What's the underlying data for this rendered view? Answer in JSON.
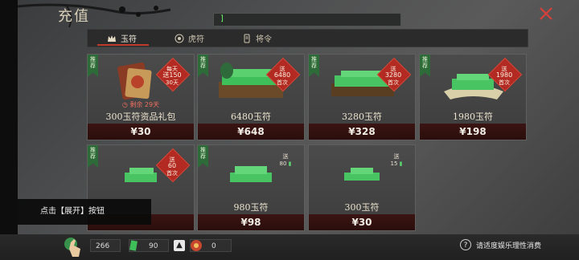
{
  "header": {
    "title": "充值",
    "search_value": "]"
  },
  "tabs": [
    {
      "label": "玉符",
      "icon": "crown-icon",
      "active": true
    },
    {
      "label": "虎符",
      "icon": "tiger-emblem-icon",
      "active": false
    },
    {
      "label": "将令",
      "icon": "order-token-icon",
      "active": false
    }
  ],
  "cards": [
    {
      "name": "300玉符资品礼包",
      "price": "¥30",
      "ribbon": "推荐",
      "badge": [
        "每天",
        "送150",
        "30天"
      ],
      "timer": "剩余 29天"
    },
    {
      "name": "6480玉符",
      "price": "¥648",
      "ribbon": "推荐",
      "badge": [
        "送",
        "6480",
        "首次"
      ]
    },
    {
      "name": "3280玉符",
      "price": "¥328",
      "ribbon": "推荐",
      "badge": [
        "送",
        "3280",
        "首次"
      ]
    },
    {
      "name": "1980玉符",
      "price": "¥198",
      "ribbon": "推荐",
      "badge": [
        "送",
        "1980",
        "首次"
      ]
    },
    {
      "name": "",
      "price": "",
      "ribbon": "推荐",
      "badge": [
        "送",
        "60",
        "首次"
      ]
    },
    {
      "name": "980玉符",
      "price": "¥98",
      "ribbon": "推荐",
      "bonus": [
        "送",
        "80"
      ]
    },
    {
      "name": "300玉符",
      "price": "¥30",
      "ribbon": "",
      "bonus": [
        "送",
        "15"
      ]
    }
  ],
  "tooltip": "点击【展开】按钮",
  "currencies": {
    "coins": "266",
    "jade": "90",
    "tokens": "0"
  },
  "notice": "请适度娱乐理性消费",
  "colors": {
    "accent_red": "#b22a22",
    "ribbon_green": "#2d6b38",
    "price_bar": "#3a1412",
    "jade": "#3fbf5a"
  }
}
